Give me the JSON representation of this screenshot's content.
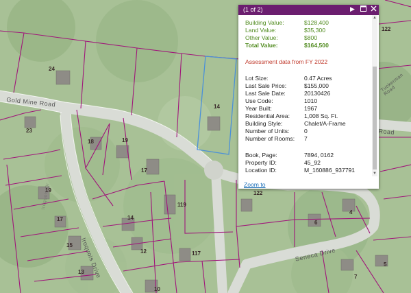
{
  "map": {
    "parcel_numbers": [
      "24",
      "14",
      "23",
      "18",
      "19",
      "17",
      "19",
      "17",
      "14",
      "119",
      "15",
      "12",
      "117",
      "13",
      "10",
      "122",
      "6",
      "4",
      "7",
      "5",
      "122"
    ],
    "road_labels": [
      "Gold Mine Road",
      "Iroquois Drive",
      "Seneca Drive",
      "Road",
      "Tuckerman Road",
      "Iroquois Dr"
    ]
  },
  "popup": {
    "counter": "(1 of 2)",
    "icons": [
      "play-icon",
      "maximize-icon",
      "close-icon"
    ],
    "values": [
      {
        "label": "Building Value:",
        "value": "$128,400"
      },
      {
        "label": "Land Value:",
        "value": "$35,300"
      },
      {
        "label": "Other Value:",
        "value": "$800"
      },
      {
        "label": "Total Value:",
        "value": "$164,500"
      }
    ],
    "assessment_note": "Assessment data from FY 2022",
    "details": [
      {
        "label": "Lot Size:",
        "value": "0.47 Acres"
      },
      {
        "label": "Last Sale Price:",
        "value": "$155,000"
      },
      {
        "label": "Last Sale Date:",
        "value": "20130426"
      },
      {
        "label": "Use Code:",
        "value": "1010"
      },
      {
        "label": "Year Built:",
        "value": "1967"
      },
      {
        "label": "Residential Area:",
        "value": "1,008 Sq. Ft."
      },
      {
        "label": "Building Style:",
        "value": "Chalet/A-Frame"
      },
      {
        "label": "Number of Units:",
        "value": "0"
      },
      {
        "label": "Number of Rooms:",
        "value": "7"
      }
    ],
    "ids": [
      {
        "label": "Book, Page:",
        "value": "7894, 0162"
      },
      {
        "label": "Property ID:",
        "value": "45_92"
      },
      {
        "label": "Location ID:",
        "value": "M_160886_937791"
      }
    ],
    "zoom_link": "Zoom to"
  },
  "colors": {
    "parcel_line": "#a0147a",
    "selected_parcel": "#4a90d9",
    "popup_header": "#6b1e6f",
    "value_green": "#4f8a1d",
    "note_red": "#c0392b",
    "link_blue": "#1c6fb8"
  }
}
